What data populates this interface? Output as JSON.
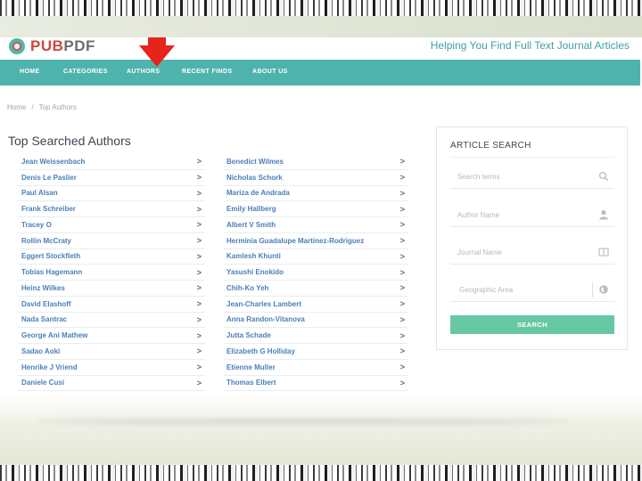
{
  "brand": {
    "name_part1": "PUB",
    "name_part2": "PDF",
    "tagline": "Helping You Find Full Text Journal Articles"
  },
  "nav": {
    "items": [
      "HOME",
      "CATEGORIES",
      "AUTHORS",
      "RECENT FINDS",
      "ABOUT US"
    ]
  },
  "breadcrumb": {
    "home": "Home",
    "separator": "/",
    "current": "Top Authors"
  },
  "section_title": "Top Searched Authors",
  "authors_col1": [
    "Jean Weissenbach",
    "Denis Le Paslier",
    "Paul Alsan",
    "Frank Schreiber",
    "Tracey O",
    "Rollin McCraty",
    "Eggert Stockfleth",
    "Tobias Hagemann",
    "Heinz Wilkes",
    "David Elashoff",
    "Nada Santrac",
    "George Ani Mathew",
    "Sadao Aoki",
    "Henrike J Vriend",
    "Daniele Cusi"
  ],
  "authors_col2": [
    "Benedict Wilmes",
    "Nicholas Schork",
    "Mariza de Andrada",
    "Emily Hallberg",
    "Albert V Smith",
    "Herminia Guadalupe Martinez-Rodriguez",
    "Kamlesh Khunti",
    "Yasushi Enokido",
    "Chih-Ko Yeh",
    "Jean-Charles Lambert",
    "Anna Randon-Vitanova",
    "Jutta Schade",
    "Elizabeth G Holliday",
    "Etienne Muller",
    "Thomas Elbert"
  ],
  "chevron": ">",
  "sidebar": {
    "title": "ARTICLE SEARCH",
    "fields": [
      {
        "placeholder": "Search terms",
        "icon": "search-icon"
      },
      {
        "placeholder": "Author Name",
        "icon": "user-icon"
      },
      {
        "placeholder": "Journal Name",
        "icon": "book-icon"
      },
      {
        "placeholder": "Geographic Area",
        "icon": "globe-icon"
      }
    ],
    "button_label": "SEARCH"
  },
  "colors": {
    "nav_bg": "#4fb3ad",
    "link": "#4a7fb7",
    "button": "#67c9a4",
    "arrow": "#e8231c"
  }
}
